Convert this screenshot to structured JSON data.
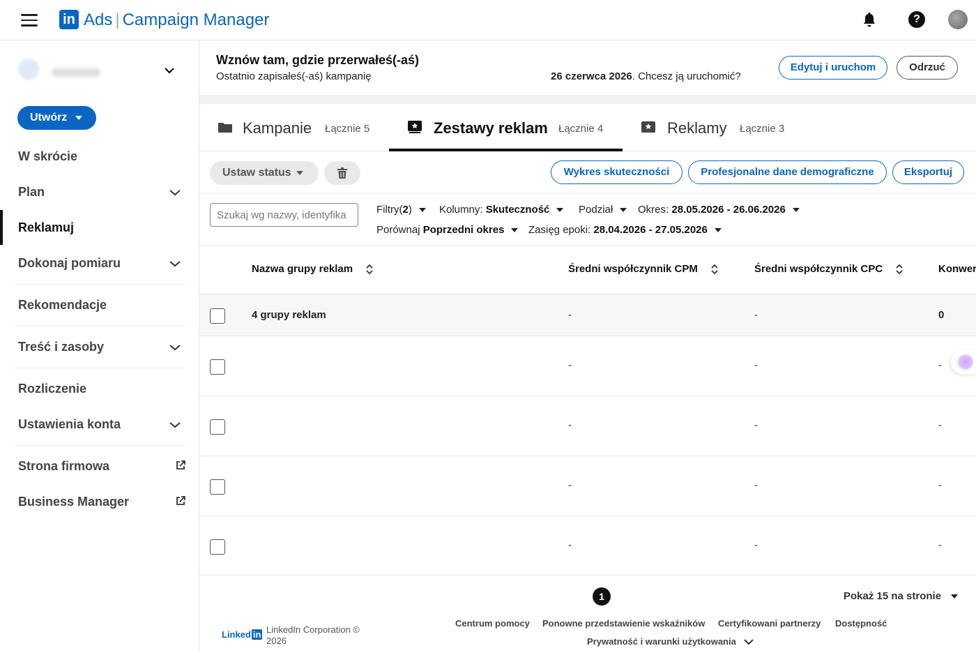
{
  "topbar": {
    "brand_ads": "Ads",
    "brand_separator": "|",
    "brand_cm": "Campaign Manager",
    "logo_text": "in",
    "help_symbol": "?",
    "icons": [
      "menu-icon",
      "bell-icon",
      "help-icon",
      "avatar"
    ]
  },
  "sidebar": {
    "create_label": "Utwórz",
    "items": [
      {
        "label": "W skrócie"
      },
      {
        "label": "Plan"
      },
      {
        "label": "Reklamuj"
      },
      {
        "label": "Dokonaj pomiaru"
      },
      {
        "label": "Rekomendacje"
      },
      {
        "label": "Treść i zasoby"
      },
      {
        "label": "Rozliczenie"
      },
      {
        "label": "Ustawienia konta"
      },
      {
        "label": "Strona firmowa"
      },
      {
        "label": "Business Manager"
      }
    ]
  },
  "banner": {
    "title": "Wznów tam, gdzie przerwałeś(-aś)",
    "subtitle": "Ostatnio zapisałeś(-aś) kampanię",
    "date": "26 czerwca 2026",
    "question": ". Chcesz ją uruchomić?",
    "edit_label": "Edytuj i uruchom",
    "dismiss_label": "Odrzuć"
  },
  "tabs": [
    {
      "label": "Kampanie",
      "count": "Łącznie 5"
    },
    {
      "label": "Zestawy reklam",
      "count": "Łącznie 4"
    },
    {
      "label": "Reklamy",
      "count": "Łącznie 3"
    }
  ],
  "toolbar": {
    "status_label": "Ustaw status",
    "chart_label": "Wykres skuteczności",
    "demographics_label": "Profesjonalne dane demograficzne",
    "export_label": "Eksportuj"
  },
  "filters": {
    "search_placeholder": "Szukaj wg nazwy, identyfika",
    "filters_prefix": "Filtry(",
    "filters_count": "2",
    "filters_suffix": ")",
    "columns_prefix": "Kolumny:",
    "columns_value": "Skuteczność",
    "breakdown": "Podział",
    "period_prefix": "Okres:",
    "period_value": "28.05.2026 - 26.06.2026",
    "compare_prefix": "Porównaj",
    "compare_value": "Poprzedni okres",
    "epoch_prefix": "Zasięg epoki:",
    "epoch_value": "28.04.2026 - 27.05.2026"
  },
  "table": {
    "headers": [
      "Nazwa grupy reklam",
      "Średni współczynnik CPM",
      "Średni współczynnik CPC",
      "Konwer"
    ],
    "total_row": {
      "name": "4 grupy reklam",
      "cpm": "-",
      "cpc": "-",
      "conv": "0"
    },
    "rows": [
      {
        "cpm": "-",
        "cpc": "-",
        "conv": "-"
      },
      {
        "cpm": "-",
        "cpc": "-",
        "conv": "-"
      },
      {
        "cpm": "-",
        "cpc": "-",
        "conv": "-"
      },
      {
        "cpm": "-",
        "cpc": "-",
        "conv": "-"
      }
    ]
  },
  "pager": {
    "current_page": "1",
    "per_page": "Pokaż 15 na stronie"
  },
  "footer": {
    "logo_text": "Linked",
    "logo_in": "in",
    "copyright": "LinkedIn Corporation © 2026",
    "links": [
      "Centrum pomocy",
      "Ponowne przedstawienie wskaźników",
      "Certyfikowani partnerzy",
      "Dostępność",
      "Prywatność i warunki użytkowania"
    ]
  },
  "colors": {
    "brand": "#0a66c2",
    "active_tab": "#111111"
  }
}
